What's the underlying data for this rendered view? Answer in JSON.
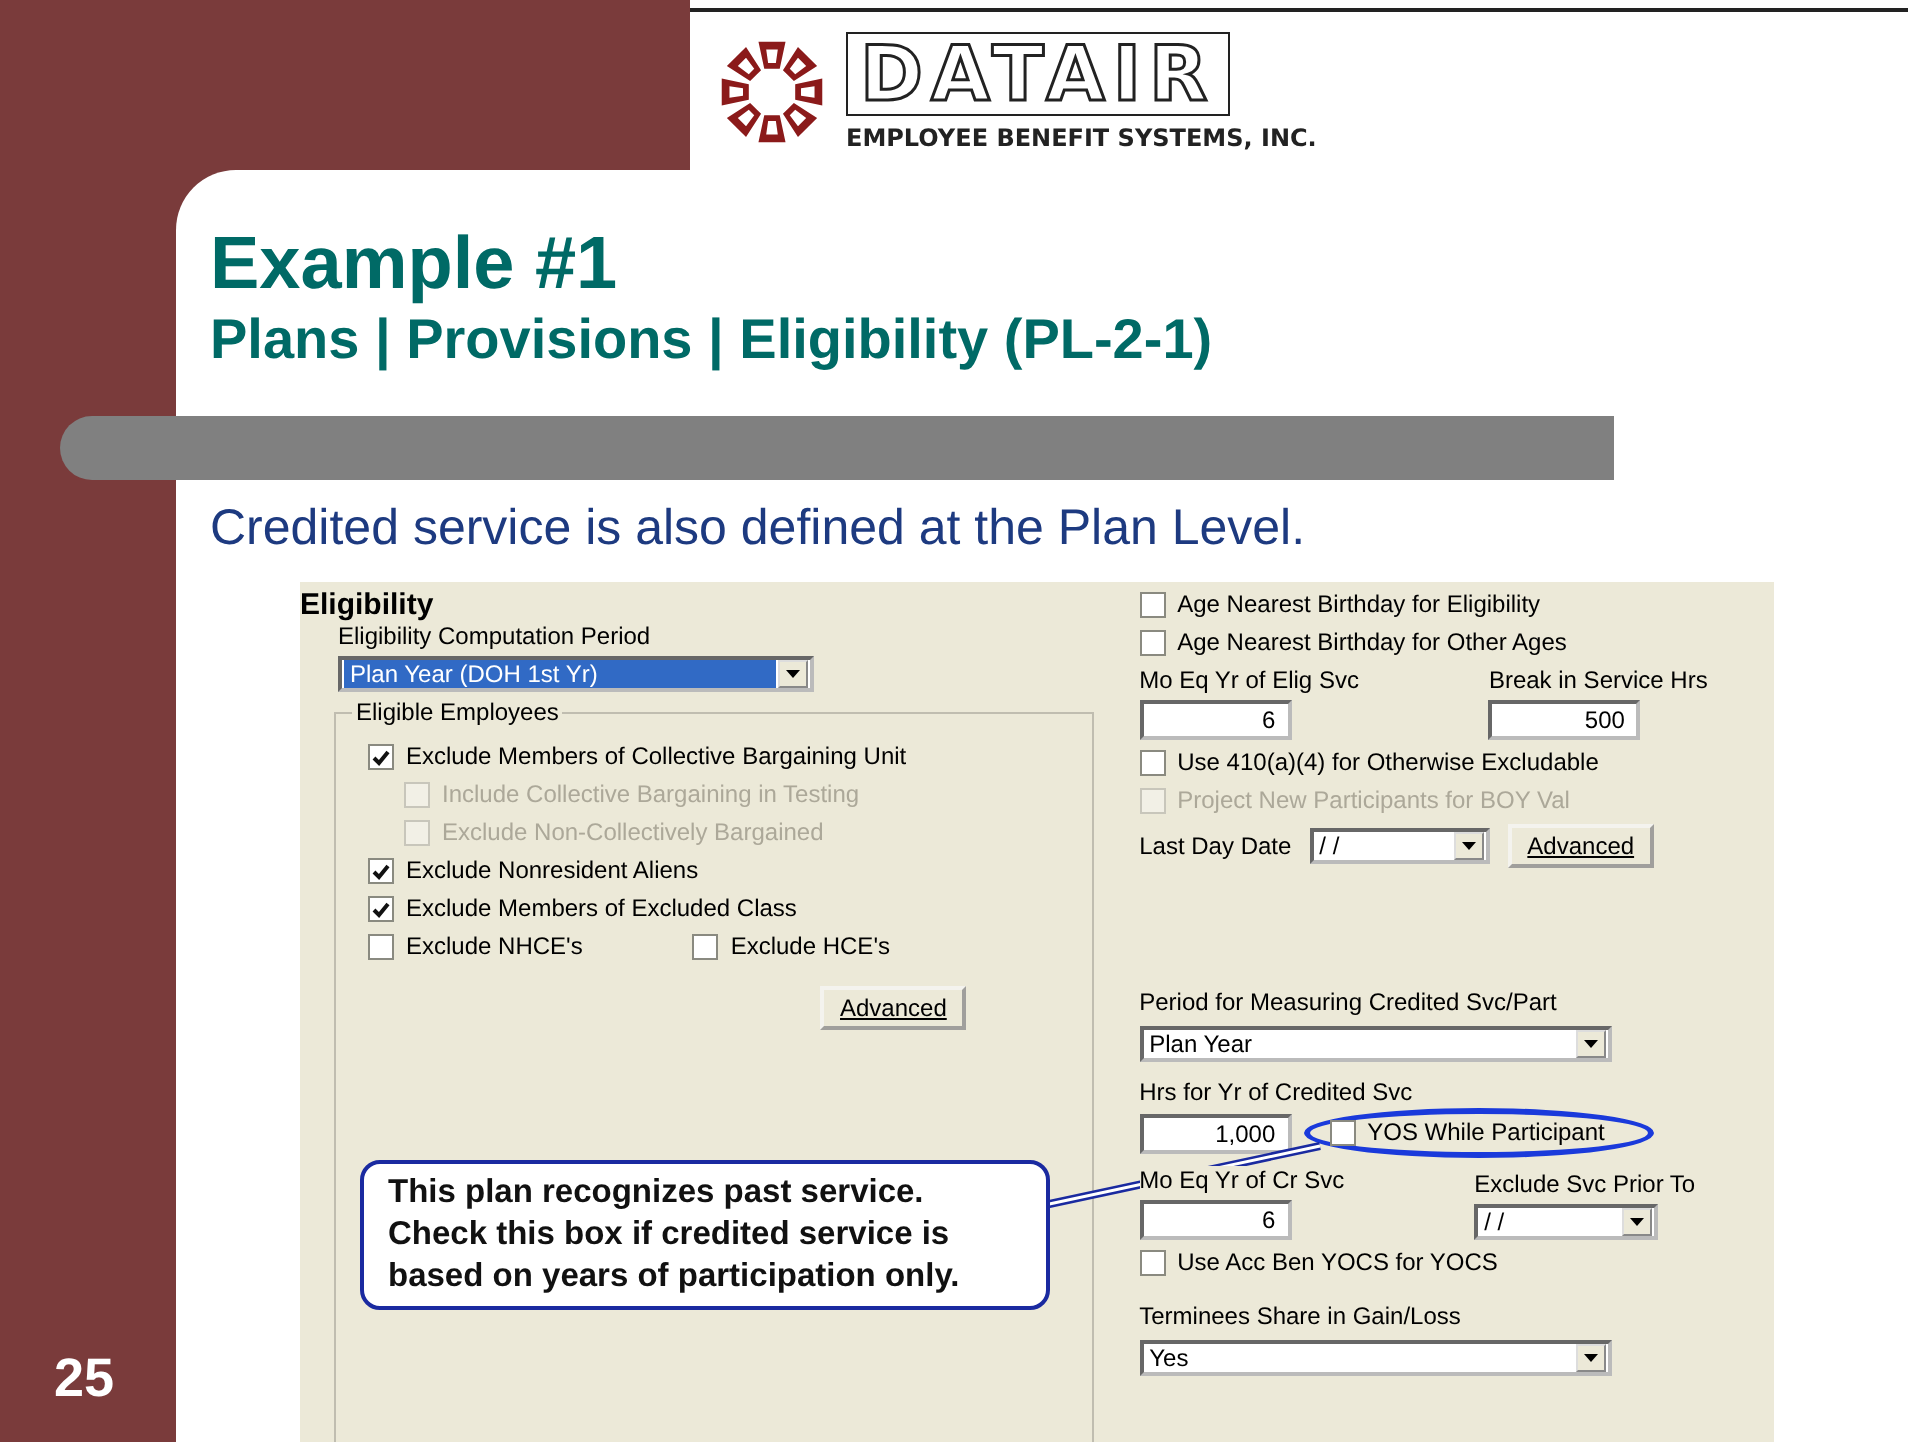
{
  "header": {
    "logo_name": "DATAIR",
    "logo_tagline": "EMPLOYEE BENEFIT SYSTEMS, INC."
  },
  "slide": {
    "title": "Example #1",
    "subtitle": "Plans | Provisions | Eligibility (PL-2-1)",
    "intro": "Credited service is also defined at the Plan Level.",
    "page_number": "25"
  },
  "left": {
    "section_title": "Eligibility",
    "period_label": "Eligibility Computation Period",
    "period_value": "Plan Year (DOH 1st Yr)",
    "group_title": "Eligible Employees",
    "options": [
      {
        "label": "Exclude Members of Collective Bargaining Unit",
        "checked": true,
        "disabled": false,
        "children": [
          {
            "label": "Include Collective Bargaining in Testing",
            "checked": false,
            "disabled": true
          },
          {
            "label": "Exclude Non-Collectively Bargained",
            "checked": false,
            "disabled": true
          }
        ]
      },
      {
        "label": "Exclude Nonresident Aliens",
        "checked": true,
        "disabled": false
      },
      {
        "label": "Exclude Members of Excluded Class",
        "checked": true,
        "disabled": false
      }
    ],
    "pair_options": [
      {
        "label": "Exclude NHCE's",
        "checked": false,
        "disabled": false
      },
      {
        "label": "Exclude HCE's",
        "checked": false,
        "disabled": false
      }
    ],
    "advanced_button": "Advanced"
  },
  "right": {
    "age_options": [
      {
        "label": "Age Nearest Birthday for Eligibility",
        "checked": false,
        "disabled": false
      },
      {
        "label": "Age Nearest Birthday for Other Ages",
        "checked": false,
        "disabled": false
      }
    ],
    "elig_fields": [
      {
        "label": "Mo Eq Yr of Elig Svc",
        "value": "6"
      },
      {
        "label": "Break in Service Hrs",
        "value": "500"
      }
    ],
    "more_options": [
      {
        "label": "Use 410(a)(4) for Otherwise Excludable",
        "checked": false,
        "disabled": false
      },
      {
        "label": "Project New Participants for BOY Val",
        "checked": false,
        "disabled": true
      }
    ],
    "last_day_label": "Last Day Date",
    "last_day_value": "/ /",
    "advanced_button": "Advanced",
    "period_label": "Period for Measuring Credited Svc/Part",
    "period_value": "Plan Year",
    "hrs_label": "Hrs for Yr of Credited Svc",
    "hrs_value": "1,000",
    "yos_option": {
      "label": "YOS While Participant",
      "checked": false,
      "disabled": false
    },
    "cr_label": "Mo Eq Yr of Cr Svc",
    "cr_value": "6",
    "prior_label": "Exclude Svc Prior To",
    "prior_value": "/ /",
    "acc_option": {
      "label": "Use Acc Ben YOCS for YOCS",
      "checked": false,
      "disabled": false
    },
    "share_label": "Terminees Share in Gain/Loss",
    "share_value": "Yes"
  },
  "callout": {
    "text": "This plan recognizes past service.\nCheck this box if credited service is\nbased on years of participation only."
  }
}
